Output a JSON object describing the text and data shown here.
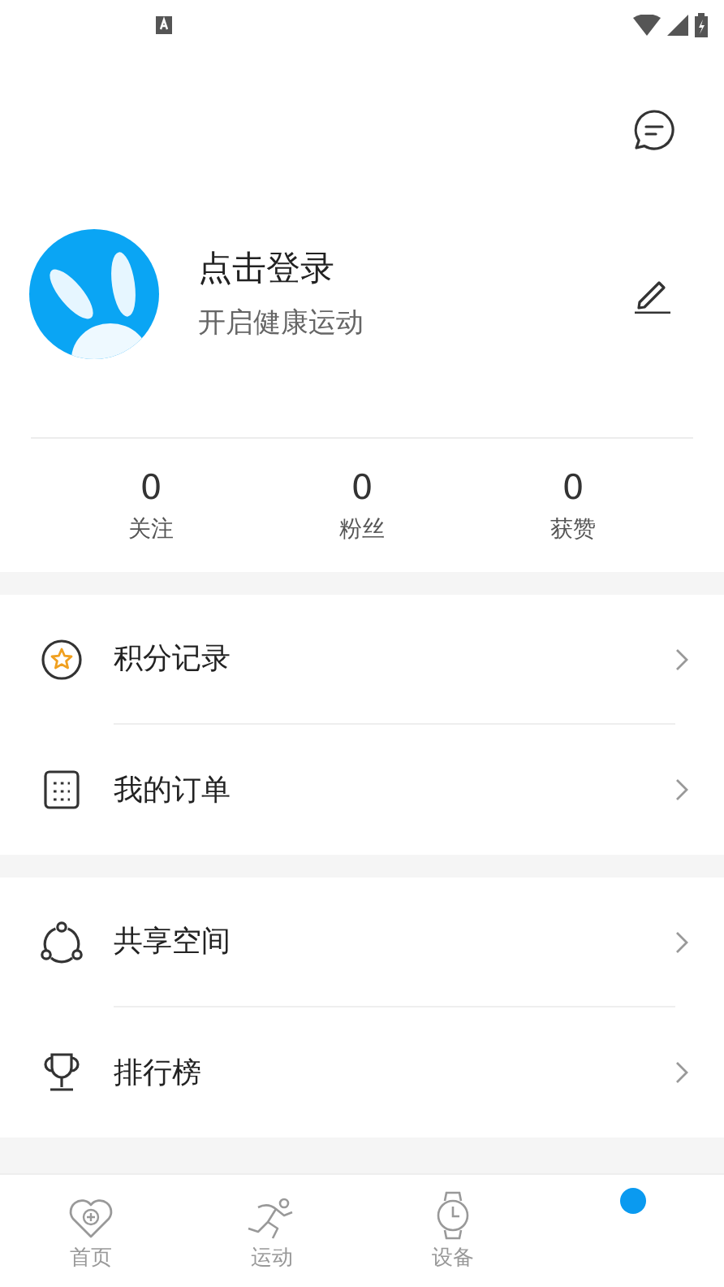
{
  "profile": {
    "name": "点击登录",
    "subtitle": "开启健康运动"
  },
  "stats": [
    {
      "value": "0",
      "label": "关注"
    },
    {
      "value": "0",
      "label": "粉丝"
    },
    {
      "value": "0",
      "label": "获赞"
    }
  ],
  "menu_groups": [
    {
      "items": [
        {
          "label": "积分记录"
        },
        {
          "label": "我的订单"
        }
      ]
    },
    {
      "items": [
        {
          "label": "共享空间"
        },
        {
          "label": "排行榜"
        }
      ]
    }
  ],
  "bottom_nav": [
    {
      "label": "首页",
      "selected": false
    },
    {
      "label": "运动",
      "selected": false
    },
    {
      "label": "设备",
      "selected": false
    }
  ]
}
